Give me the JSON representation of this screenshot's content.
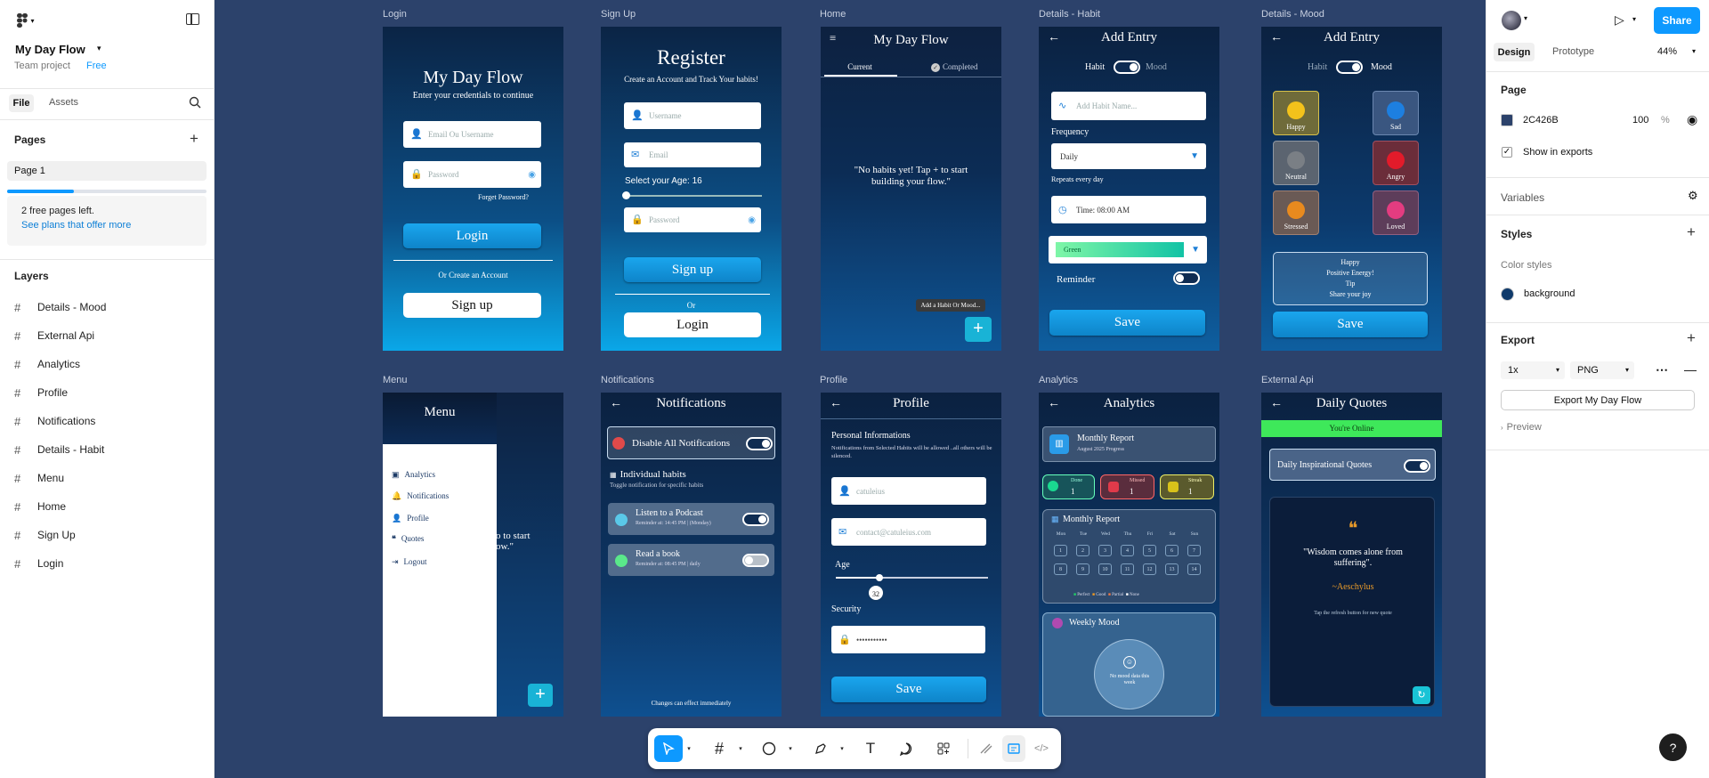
{
  "file": {
    "name": "My Day Flow",
    "team": "Team project",
    "plan": "Free"
  },
  "left": {
    "tabs": [
      "File",
      "Assets"
    ],
    "pages_title": "Pages",
    "page": "Page 1",
    "free_notice": "2 free pages left.",
    "plans_link": "See plans that offer more",
    "layers_title": "Layers",
    "layers": [
      "Details - Mood",
      "External Api",
      "Analytics",
      "Profile",
      "Notifications",
      "Details - Habit",
      "Menu",
      "Home",
      "Sign Up",
      "Login"
    ]
  },
  "right": {
    "share": "Share",
    "tabs": [
      "Design",
      "Prototype"
    ],
    "zoom": "44%",
    "page_title": "Page",
    "bg_hex": "2C426B",
    "bg_opacity": "100",
    "pct": "%",
    "show_exports": "Show in exports",
    "variables": "Variables",
    "styles": "Styles",
    "color_styles": "Color styles",
    "background": "background",
    "export": "Export",
    "scale": "1x",
    "format": "PNG",
    "export_btn": "Export My Day Flow",
    "preview": "Preview"
  },
  "frames": {
    "login": {
      "label": "Login",
      "title": "My Day Flow",
      "subtitle": "Enter your credentials to continue",
      "email_ph": "Email Ou Username",
      "pw_ph": "Password",
      "forget": "Forget Password?",
      "login": "Login",
      "or": "Or Create an Account",
      "signup": "Sign up"
    },
    "signup": {
      "label": "Sign Up",
      "title": "Register",
      "subtitle": "Create an Account and Track Your habits!",
      "user_ph": "Username",
      "email_ph": "Email",
      "age": "Select your Age: 16",
      "pw_ph": "Password",
      "signup": "Sign up",
      "or": "Or",
      "login": "Login"
    },
    "home": {
      "label": "Home",
      "title": "My Day Flow",
      "tab1": "Current",
      "tab2": "Completed",
      "empty": "\"No habits yet! Tap + to start building your flow.\"",
      "tip": "Add a Habit Or Mood..."
    },
    "habit": {
      "label": "Details - Habit",
      "title": "Add Entry",
      "habit": "Habit",
      "mood": "Mood",
      "name_ph": "Add Habit Name...",
      "freq": "Frequency",
      "daily": "Daily",
      "repeats": "Repeats every day",
      "time": "Time: 08:00 AM",
      "color": "Green",
      "reminder": "Reminder",
      "save": "Save"
    },
    "mood": {
      "label": "Details - Mood",
      "title": "Add Entry",
      "habit": "Habit",
      "mood": "Mood",
      "moods": [
        "Happy",
        "Sad",
        "Neutral",
        "Angry",
        "Stressed",
        "Loved"
      ],
      "tip": [
        "Happy",
        "Positive Energy!",
        "Tip",
        "Share your joy"
      ],
      "save": "Save"
    },
    "menu": {
      "label": "Menu",
      "title": "Menu",
      "items": [
        "Analytics",
        "Notifications",
        "Profile",
        "Quotes",
        "Logout"
      ],
      "peek": "to start\now.\""
    },
    "notif": {
      "label": "Notifications",
      "title": "Notifications",
      "disable": "Disable All Notifications",
      "indiv": "Individual habits",
      "indiv_sub": "Toggle notification for specific habits",
      "h1": "Listen to a Podcast",
      "h1_sub": "Reminder at: 14:45 PM | (Monday)",
      "h2": "Read a book",
      "h2_sub": "Reminder at: 08:45 PM | daily",
      "footer": "Changes can effect immediately"
    },
    "profile": {
      "label": "Profile",
      "title": "Profile",
      "section": "Personal Informations",
      "note": "Notifications from  Selected Habits will be allowed ..all others will be silenced.",
      "user": "catuleius",
      "email": "contact@catuleius.com",
      "age": "Age",
      "age_val": "32",
      "security": "Security",
      "pw": "•••••••••••",
      "save": "Save"
    },
    "analytics": {
      "label": "Analytics",
      "title": "Analytics",
      "report": "Monthly Report",
      "report_sub": "August 2025 Progress",
      "done": "Done",
      "done_n": "1",
      "missed": "Missed",
      "missed_n": "1",
      "streak": "Streak",
      "streak_n": "1",
      "cal_title": "Monthly Report",
      "days": [
        "Mon",
        "Tue",
        "Wed",
        "Thu",
        "Fri",
        "Sat",
        "Sun"
      ],
      "dates": [
        "1",
        "2",
        "3",
        "4",
        "5",
        "6",
        "7",
        "8",
        "9",
        "10",
        "11",
        "12",
        "13",
        "14"
      ],
      "legend": [
        "Perfect",
        "Good",
        "Partial",
        "None"
      ],
      "weekly": "Weekly Mood",
      "no_mood": "No mood data this week"
    },
    "api": {
      "label": "External Api",
      "title": "Daily Quotes",
      "online": "You're Online",
      "daily": "Daily Inspirational Quotes",
      "quote": "\"Wisdom comes alone from suffering\".",
      "author": "~Aeschylus",
      "tap": "Tap the refresh button for new quote"
    }
  },
  "colors": {
    "canvas": "#2C426B",
    "accent": "#0D99FF"
  }
}
